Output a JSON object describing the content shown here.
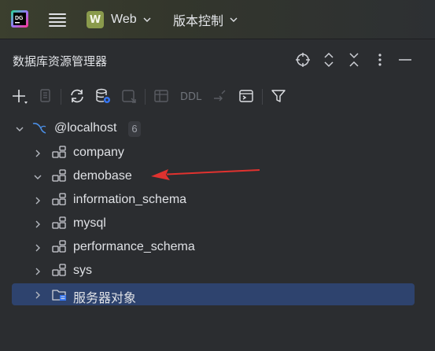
{
  "titlebar": {
    "app_logo": "DG",
    "project": {
      "badge": "W",
      "name": "Web"
    },
    "vcs_label": "版本控制"
  },
  "panel": {
    "title": "数据库资源管理器",
    "header_icons": [
      "crosshair-icon",
      "expand-icon",
      "collapse-icon",
      "more-icon",
      "minimize-icon"
    ]
  },
  "toolbar": {
    "ddl_label": "DDL",
    "icons": [
      "add-icon",
      "copy-icon",
      "refresh-icon",
      "datasource-properties-icon",
      "jump-to-console-icon",
      "table-icon",
      "ddl",
      "compare-icon",
      "console-icon",
      "filter-icon"
    ]
  },
  "tree": {
    "root": {
      "label": "@localhost",
      "count": "6",
      "expanded": true
    },
    "schemas": [
      {
        "label": "company",
        "expanded": false
      },
      {
        "label": "demobase",
        "expanded": true
      },
      {
        "label": "information_schema",
        "expanded": false
      },
      {
        "label": "mysql",
        "expanded": false
      },
      {
        "label": "performance_schema",
        "expanded": false
      },
      {
        "label": "sys",
        "expanded": false
      }
    ],
    "server_objects": {
      "label": "服务器对象",
      "selected": true
    }
  },
  "colors": {
    "background": "#2b2d30",
    "selection": "#2e436e",
    "annotation_arrow": "#e0322f",
    "mysql_icon": "#4b8fe6"
  }
}
